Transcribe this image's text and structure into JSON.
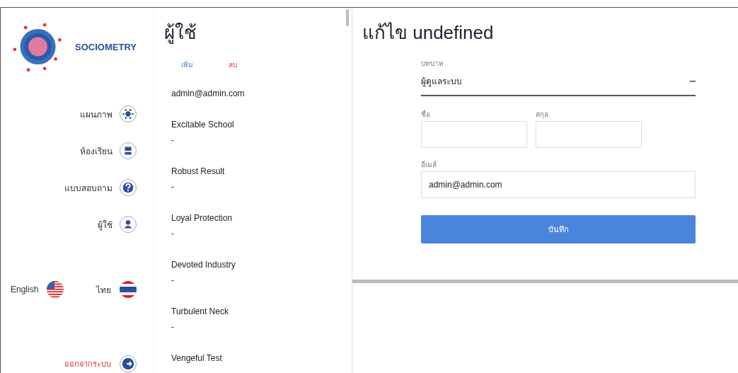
{
  "brand": {
    "name": "SOCIOMETRY"
  },
  "nav": [
    {
      "label": "แผนภาพ",
      "kind": "diagram"
    },
    {
      "label": "ห้องเรียน",
      "kind": "classroom"
    },
    {
      "label": "แบบสอบถาม",
      "kind": "question"
    },
    {
      "label": "ผู้ใช้",
      "kind": "user"
    }
  ],
  "languages": [
    {
      "label": "English",
      "kind": "us"
    },
    {
      "label": "ไทย",
      "kind": "th"
    }
  ],
  "logout": {
    "label": "ออกจากระบบ"
  },
  "users_panel": {
    "title": "ผู้ใช้",
    "add": "เพิ่ม",
    "delete": "ลบ",
    "users": [
      {
        "name": "admin@admin.com"
      },
      {
        "name": "Excitable School",
        "detail": "-"
      },
      {
        "name": "Robust Result",
        "detail": "-"
      },
      {
        "name": "Loyal Protection",
        "detail": "-"
      },
      {
        "name": "Devoted Industry",
        "detail": "-"
      },
      {
        "name": "Turbulent Neck",
        "detail": "-"
      },
      {
        "name": "Vengeful Test"
      }
    ]
  },
  "editor": {
    "title": "แก้ไข undefined",
    "role": {
      "label": "บทบาท",
      "value": "ผู้ดูแลระบบ"
    },
    "first_name": {
      "label": "ชื่อ"
    },
    "last_name": {
      "label": "สกุล"
    },
    "email": {
      "label": "อีเมล์",
      "value": "admin@admin.com"
    },
    "save": "บันทึก"
  }
}
